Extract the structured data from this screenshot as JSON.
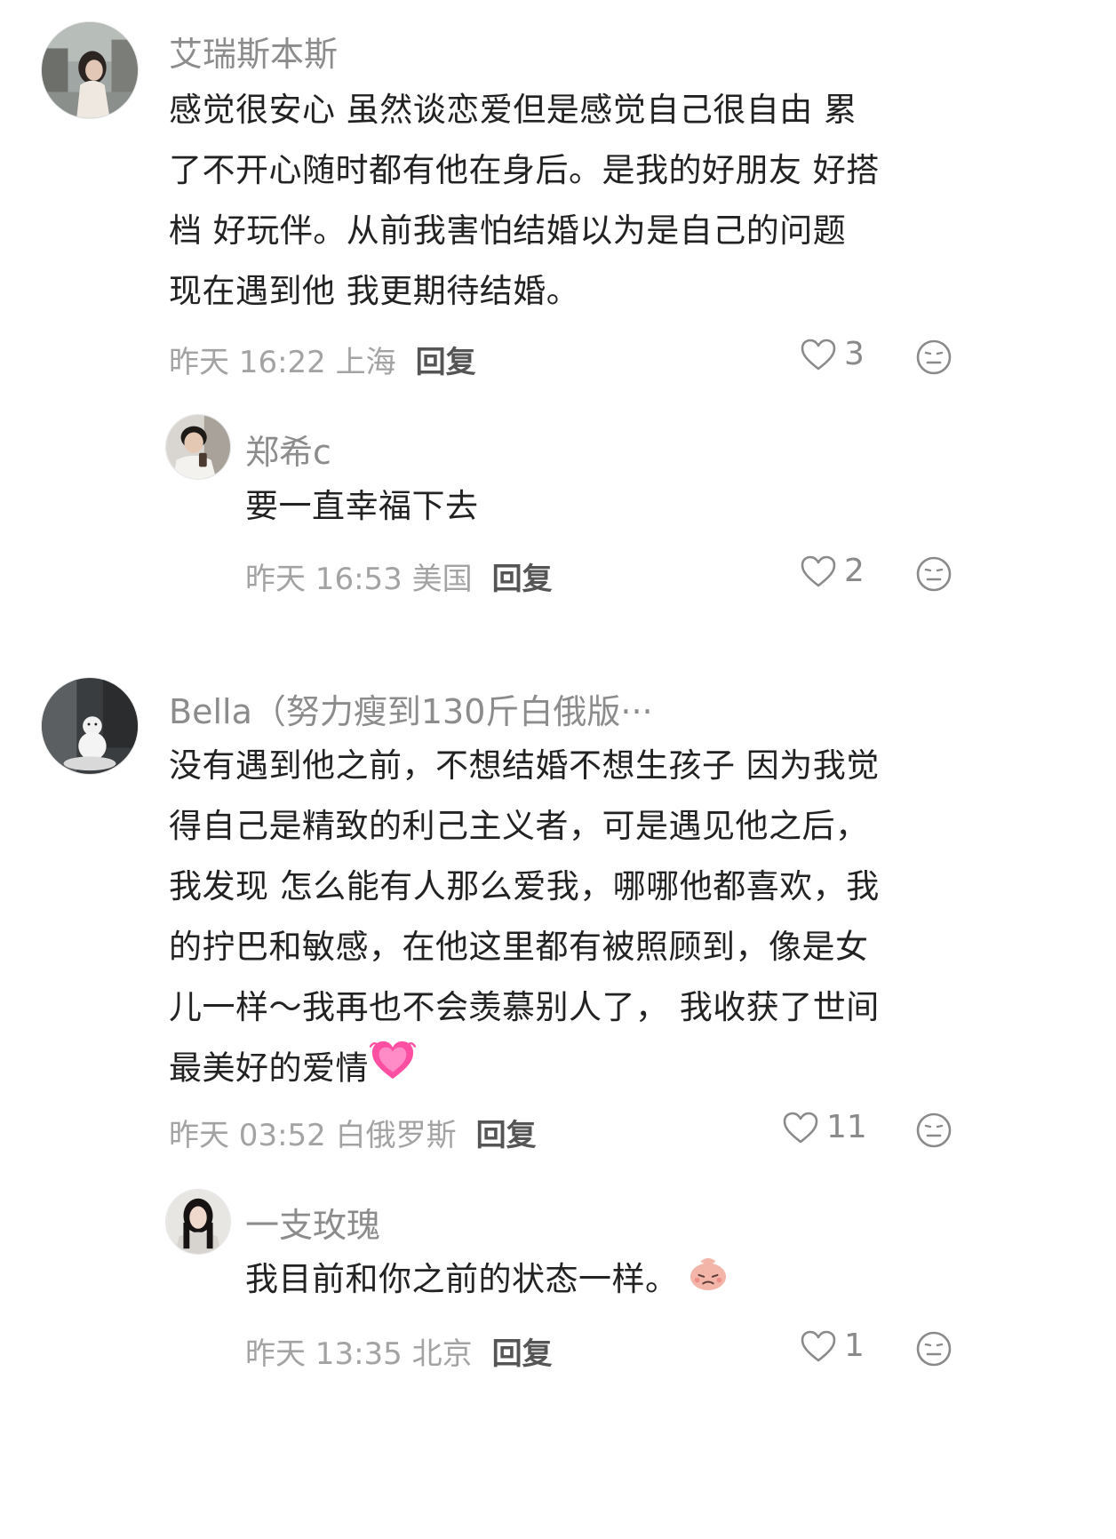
{
  "comments": [
    {
      "username": "艾瑞斯本斯",
      "lines": [
        "感觉很安心 虽然谈恋爱但是感觉自己很自由 累",
        "了不开心随时都有他在身后。是我的好朋友 好搭",
        "档 好玩伴。从前我害怕结婚以为是自己的问题",
        "现在遇到他 我更期待结婚。"
      ],
      "time": "昨天 16:22 上海",
      "reply_label": "回复",
      "likes": "3"
    },
    {
      "username": "郑希c",
      "lines": [
        "要一直幸福下去"
      ],
      "time": "昨天 16:53 美国",
      "reply_label": "回复",
      "likes": "2"
    },
    {
      "username": "Bella（努力瘦到130斤白俄版···",
      "lines": [
        "没有遇到他之前，不想结婚不想生孩子 因为我觉",
        "得自己是精致的利己主义者，可是遇见他之后，",
        "我发现 怎么能有人那么爱我，哪哪他都喜欢，我",
        "的拧巴和敏感，在他这里都有被照顾到，像是女",
        "儿一样～我再也不会羡慕别人了， 我收获了世间",
        "最美好的爱情"
      ],
      "time": "昨天 03:52 白俄罗斯",
      "reply_label": "回复",
      "likes": "11"
    },
    {
      "username": "一支玫瑰",
      "lines": [
        "我目前和你之前的状态一样。"
      ],
      "time": "昨天 13:35 北京",
      "reply_label": "回复",
      "likes": "1"
    }
  ],
  "icons": {
    "like": "heart-outline-icon",
    "dislike": "neutral-face-icon",
    "sticker_heart": "growing-heart-emoji",
    "sticker_sad": "sad-face-sticker"
  },
  "colors": {
    "text": "#222222",
    "username": "#8c8c8c",
    "meta": "#a3a3a3",
    "reply_button": "#555555",
    "heart_emoji": "#ff4fa3"
  }
}
